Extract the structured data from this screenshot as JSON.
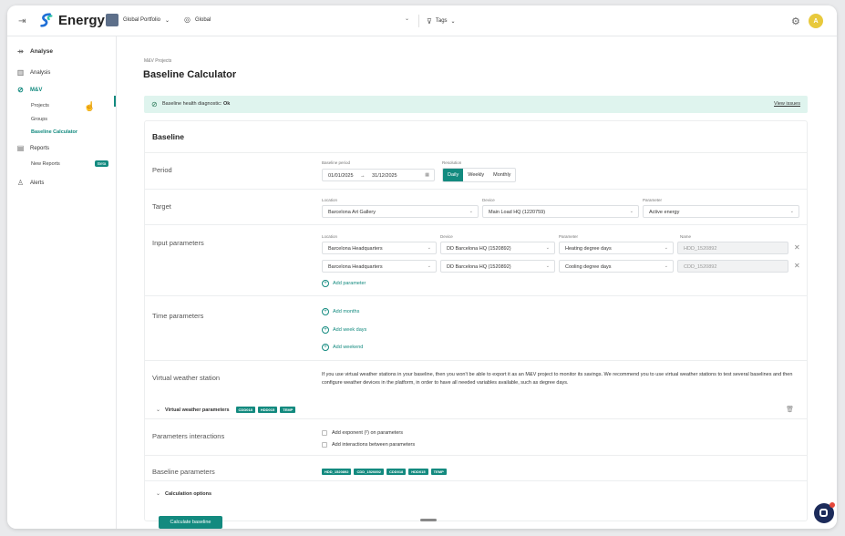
{
  "topbar": {
    "app_name": "Energy",
    "portfolio": "Global Portfolio",
    "scope": "Global",
    "tags_label": "Tags",
    "avatar_initial": "A"
  },
  "sidebar": {
    "analyse_label": "Analyse",
    "analysis_label": "Analysis",
    "mv_label": "M&V",
    "projects_label": "Projects",
    "groups_label": "Groups",
    "baseline_calculator_label": "Baseline Calculator",
    "reports_label": "Reports",
    "new_reports_label": "New Reports",
    "beta_label": "Beta",
    "alerts_label": "Alerts"
  },
  "page": {
    "breadcrumb": "M&V Projects",
    "title": "Baseline Calculator"
  },
  "banner": {
    "text": "Baseline health diagnostic:",
    "status": "Ok",
    "link": "View issues"
  },
  "baseline": {
    "title": "Baseline",
    "period": {
      "label": "Period",
      "field_label": "Baseline period",
      "start": "01/01/2025",
      "arrow": "→",
      "end": "31/12/2025",
      "resolution_label": "Resolution",
      "resolutions": [
        "Daily",
        "Weekly",
        "Monthly"
      ],
      "selected_resolution": "Daily"
    },
    "target": {
      "label": "Target",
      "location_label": "Location",
      "location": "Barcelona Art Gallery",
      "device_label": "Device",
      "device": "Main Load HQ (1220759)",
      "parameter_label": "Parameter",
      "parameter": "Active energy"
    },
    "input_parameters": {
      "label": "Input parameters",
      "location_label": "Location",
      "device_label": "Device",
      "parameter_label": "Parameter",
      "name_label": "Name",
      "rows": [
        {
          "location": "Barcelona Headquarters",
          "device": "DD Barcelona HQ (1520892)",
          "parameter": "Heating degree days",
          "name": "HDD_1520892"
        },
        {
          "location": "Barcelona Headquarters",
          "device": "DD Barcelona HQ (1520892)",
          "parameter": "Cooling degree days",
          "name": "CDD_1520892"
        }
      ],
      "add_label": "Add parameter"
    },
    "time_parameters": {
      "label": "Time parameters",
      "add_months": "Add months",
      "add_week_days": "Add week days",
      "add_weekend": "Add weekend"
    },
    "virtual_weather_station": {
      "label": "Virtual weather station",
      "text": "If you use virtual weather stations in your baseline, then you won't be able to export it as an M&V project to monitor its savings. We recommend you to use virtual weather stations to test several baselines and then configure weather devices in the platform, in order to have all needed variables available, such as degree days."
    },
    "virtual_weather_parameters": {
      "label": "Virtual weather parameters",
      "tags": [
        "CDD018",
        "HDD015",
        "TEMP"
      ]
    },
    "parameters_interactions": {
      "label": "Parameters interactions",
      "option1": "Add exponent (²) on parameters",
      "option2": "Add interactions between parameters"
    },
    "baseline_parameters": {
      "label": "Baseline parameters",
      "tags": [
        "HDD_1520892",
        "CDD_1520892",
        "CDD018",
        "HDD015",
        "TEMP"
      ]
    },
    "calculation_options_label": "Calculation options",
    "calculate_button": "Calculate baseline"
  }
}
